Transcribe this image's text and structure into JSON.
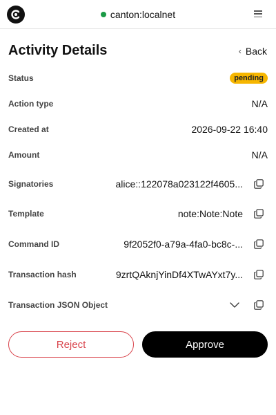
{
  "topbar": {
    "network_label": "canton:localnet",
    "network_status_color": "#1a9a45",
    "logo_icon": "canton-logo-icon",
    "menu_icon": "hamburger-menu-icon"
  },
  "header": {
    "title": "Activity Details",
    "back_label": "Back"
  },
  "details": {
    "status": {
      "label": "Status",
      "value": "pending",
      "badge_color": "#f6b600"
    },
    "action_type": {
      "label": "Action type",
      "value": "N/A"
    },
    "created_at": {
      "label": "Created at",
      "value": "2026-09-22 16:40"
    },
    "amount": {
      "label": "Amount",
      "value": "N/A"
    },
    "signatories": {
      "label": "Signatories",
      "value": "alice::122078a023122f4605..."
    },
    "template": {
      "label": "Template",
      "value": "note:Note:Note"
    },
    "command_id": {
      "label": "Command ID",
      "value": "9f2052f0-a79a-4fa0-bc8c-..."
    },
    "transaction_hash": {
      "label": "Transaction hash",
      "value": "9zrtQAknjYinDf4XTwAYxt7y..."
    },
    "transaction_json": {
      "label": "Transaction JSON Object"
    }
  },
  "actions": {
    "reject_label": "Reject",
    "approve_label": "Approve",
    "reject_color": "#d9434b"
  }
}
